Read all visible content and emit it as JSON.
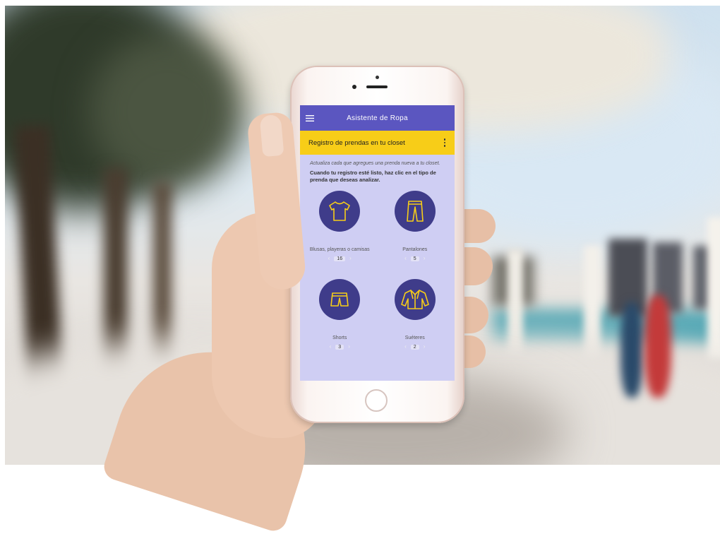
{
  "app": {
    "title": "Asistente de Ropa"
  },
  "section": {
    "title": "Registro de prendas en tu closet"
  },
  "intro": {
    "italic": "Actualiza cada que agregues una prenda nueva a tu closet.",
    "bold": "Cuando tu registro esté listo, haz clic en el tipo de prenda que deseas analizar."
  },
  "categories": [
    {
      "label": "Blusas, playeras o camisas",
      "count": "16",
      "icon": "shirt-icon"
    },
    {
      "label": "Pantalones",
      "count": "5",
      "icon": "pants-icon"
    },
    {
      "label": "Shorts",
      "count": "3",
      "icon": "shorts-icon"
    },
    {
      "label": "Suéteres",
      "count": "2",
      "icon": "sweater-icon"
    }
  ],
  "colors": {
    "appbar": "#5b56c0",
    "section_bar": "#f7cd18",
    "icon_circle": "#3f3c8a",
    "icon_stroke": "#f7cd18",
    "screen_bg": "#cfcef3"
  }
}
